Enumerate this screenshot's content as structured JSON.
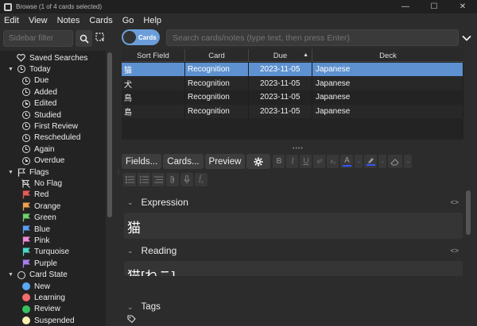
{
  "window": {
    "title": "Browse (1 of 4 cards selected)",
    "minimize": "—",
    "maximize": "☐",
    "close": "✕"
  },
  "menu": [
    "Edit",
    "View",
    "Notes",
    "Cards",
    "Go",
    "Help"
  ],
  "sidebar": {
    "filter_placeholder": "Sidebar filter",
    "items": [
      {
        "label": "Saved Searches",
        "icon": "heart-icon",
        "level": 0
      },
      {
        "label": "Today",
        "icon": "clock-icon",
        "level": 0,
        "expanded": true
      },
      {
        "label": "Due",
        "icon": "clock-icon",
        "level": 1
      },
      {
        "label": "Added",
        "icon": "clock-icon",
        "level": 1
      },
      {
        "label": "Edited",
        "icon": "clock-icon",
        "level": 1
      },
      {
        "label": "Studied",
        "icon": "clock-icon",
        "level": 1
      },
      {
        "label": "First Review",
        "icon": "clock-icon",
        "level": 1
      },
      {
        "label": "Rescheduled",
        "icon": "clock-icon",
        "level": 1
      },
      {
        "label": "Again",
        "icon": "clock-icon",
        "level": 1
      },
      {
        "label": "Overdue",
        "icon": "clock-icon",
        "level": 1
      },
      {
        "label": "Flags",
        "icon": "flag-icon",
        "level": 0,
        "expanded": true
      },
      {
        "label": "No Flag",
        "icon": "no-flag-icon",
        "level": 1
      },
      {
        "label": "Red",
        "icon": "flag-icon",
        "color": "#e85a5a",
        "level": 1
      },
      {
        "label": "Orange",
        "icon": "flag-icon",
        "color": "#f0a050",
        "level": 1
      },
      {
        "label": "Green",
        "icon": "flag-icon",
        "color": "#6dd36d",
        "level": 1
      },
      {
        "label": "Blue",
        "icon": "flag-icon",
        "color": "#5aa0f0",
        "level": 1
      },
      {
        "label": "Pink",
        "icon": "flag-icon",
        "color": "#f08ad8",
        "level": 1
      },
      {
        "label": "Turquoise",
        "icon": "flag-icon",
        "color": "#4ed6c6",
        "level": 1
      },
      {
        "label": "Purple",
        "icon": "flag-icon",
        "color": "#a87ef0",
        "level": 1
      },
      {
        "label": "Card State",
        "icon": "ring-icon",
        "level": 0,
        "expanded": true
      },
      {
        "label": "New",
        "icon": "dot-icon",
        "color": "#5aa7f5",
        "level": 1
      },
      {
        "label": "Learning",
        "icon": "dot-icon",
        "color": "#f26d6d",
        "level": 1
      },
      {
        "label": "Review",
        "icon": "dot-icon",
        "color": "#36c15e",
        "level": 1
      },
      {
        "label": "Suspended",
        "icon": "dot-icon",
        "color": "#f7f0b0",
        "level": 1
      }
    ]
  },
  "search": {
    "toggle_label": "Cards",
    "placeholder": "Search cards/notes (type text, then press Enter)"
  },
  "table": {
    "columns": [
      "Sort Field",
      "Card",
      "Due",
      "Deck"
    ],
    "rows": [
      {
        "sort_field": "猫",
        "card": "Recognition",
        "due": "2023-11-05",
        "deck": "Japanese",
        "selected": true
      },
      {
        "sort_field": "犬",
        "card": "Recognition",
        "due": "2023-11-05",
        "deck": "Japanese"
      },
      {
        "sort_field": "鳥",
        "card": "Recognition",
        "due": "2023-11-05",
        "deck": "Japanese"
      },
      {
        "sort_field": "島",
        "card": "Recognition",
        "due": "2023-11-05",
        "deck": "Japanese"
      }
    ]
  },
  "editor": {
    "fields_btn": "Fields...",
    "cards_btn": "Cards...",
    "preview_btn": "Preview",
    "fields": [
      {
        "label": "Expression",
        "value": "猫"
      },
      {
        "label": "Reading",
        "value": "猫[ねこ]"
      }
    ],
    "tags_label": "Tags"
  },
  "colors": {
    "accent": "#6b9ed9",
    "selection": "#5e91cf"
  }
}
